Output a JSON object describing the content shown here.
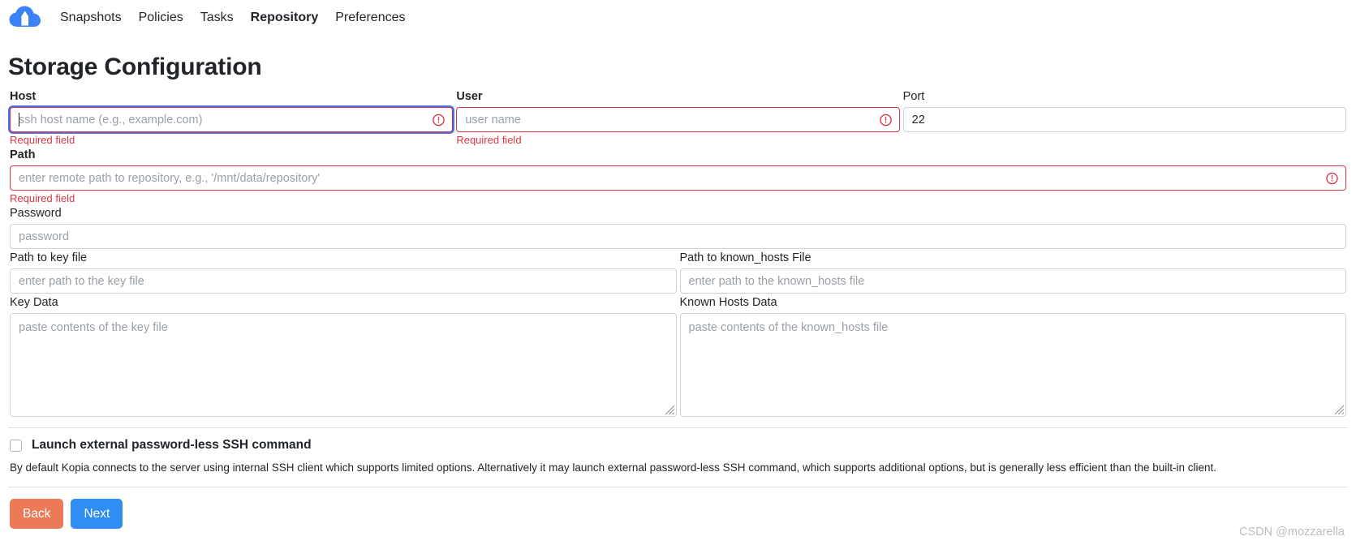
{
  "navbar": {
    "logo_icon": "cloud-upload-logo-icon",
    "logo_color": "#3b82f6",
    "links": [
      {
        "label": "Snapshots",
        "active": false
      },
      {
        "label": "Policies",
        "active": false
      },
      {
        "label": "Tasks",
        "active": false
      },
      {
        "label": "Repository",
        "active": true
      },
      {
        "label": "Preferences",
        "active": false
      }
    ]
  },
  "page": {
    "title": "Storage Configuration"
  },
  "fields": {
    "host": {
      "label": "Host",
      "placeholder": "ssh host name (e.g., example.com)",
      "value": "",
      "error": "Required field"
    },
    "user": {
      "label": "User",
      "placeholder": "user name",
      "value": "",
      "error": "Required field"
    },
    "port": {
      "label": "Port",
      "placeholder": "",
      "value": "22"
    },
    "path": {
      "label": "Path",
      "placeholder": "enter remote path to repository, e.g., '/mnt/data/repository'",
      "value": "",
      "error": "Required field"
    },
    "password": {
      "label": "Password",
      "placeholder": "password",
      "value": ""
    },
    "key_file_path": {
      "label": "Path to key file",
      "placeholder": "enter path to the key file",
      "value": ""
    },
    "known_hosts_path": {
      "label": "Path to known_hosts File",
      "placeholder": "enter path to the known_hosts file",
      "value": ""
    },
    "key_data": {
      "label": "Key Data",
      "placeholder": "paste contents of the key file",
      "value": ""
    },
    "known_hosts_data": {
      "label": "Known Hosts Data",
      "placeholder": "paste contents of the known_hosts file",
      "value": ""
    }
  },
  "external_ssh": {
    "checkbox_label": "Launch external password-less SSH command",
    "checked": false,
    "help_text": "By default Kopia connects to the server using internal SSH client which supports limited options. Alternatively it may launch external password-less SSH command, which supports additional options, but is generally less efficient than the built-in client."
  },
  "footer": {
    "back_label": "Back",
    "next_label": "Next",
    "back_color": "#ec7a56",
    "next_color": "#2f8ef4"
  },
  "watermark": {
    "text": "CSDN @mozzarella"
  },
  "icons": {
    "error": "exclamation-circle-icon",
    "error_color": "#dc3545"
  }
}
